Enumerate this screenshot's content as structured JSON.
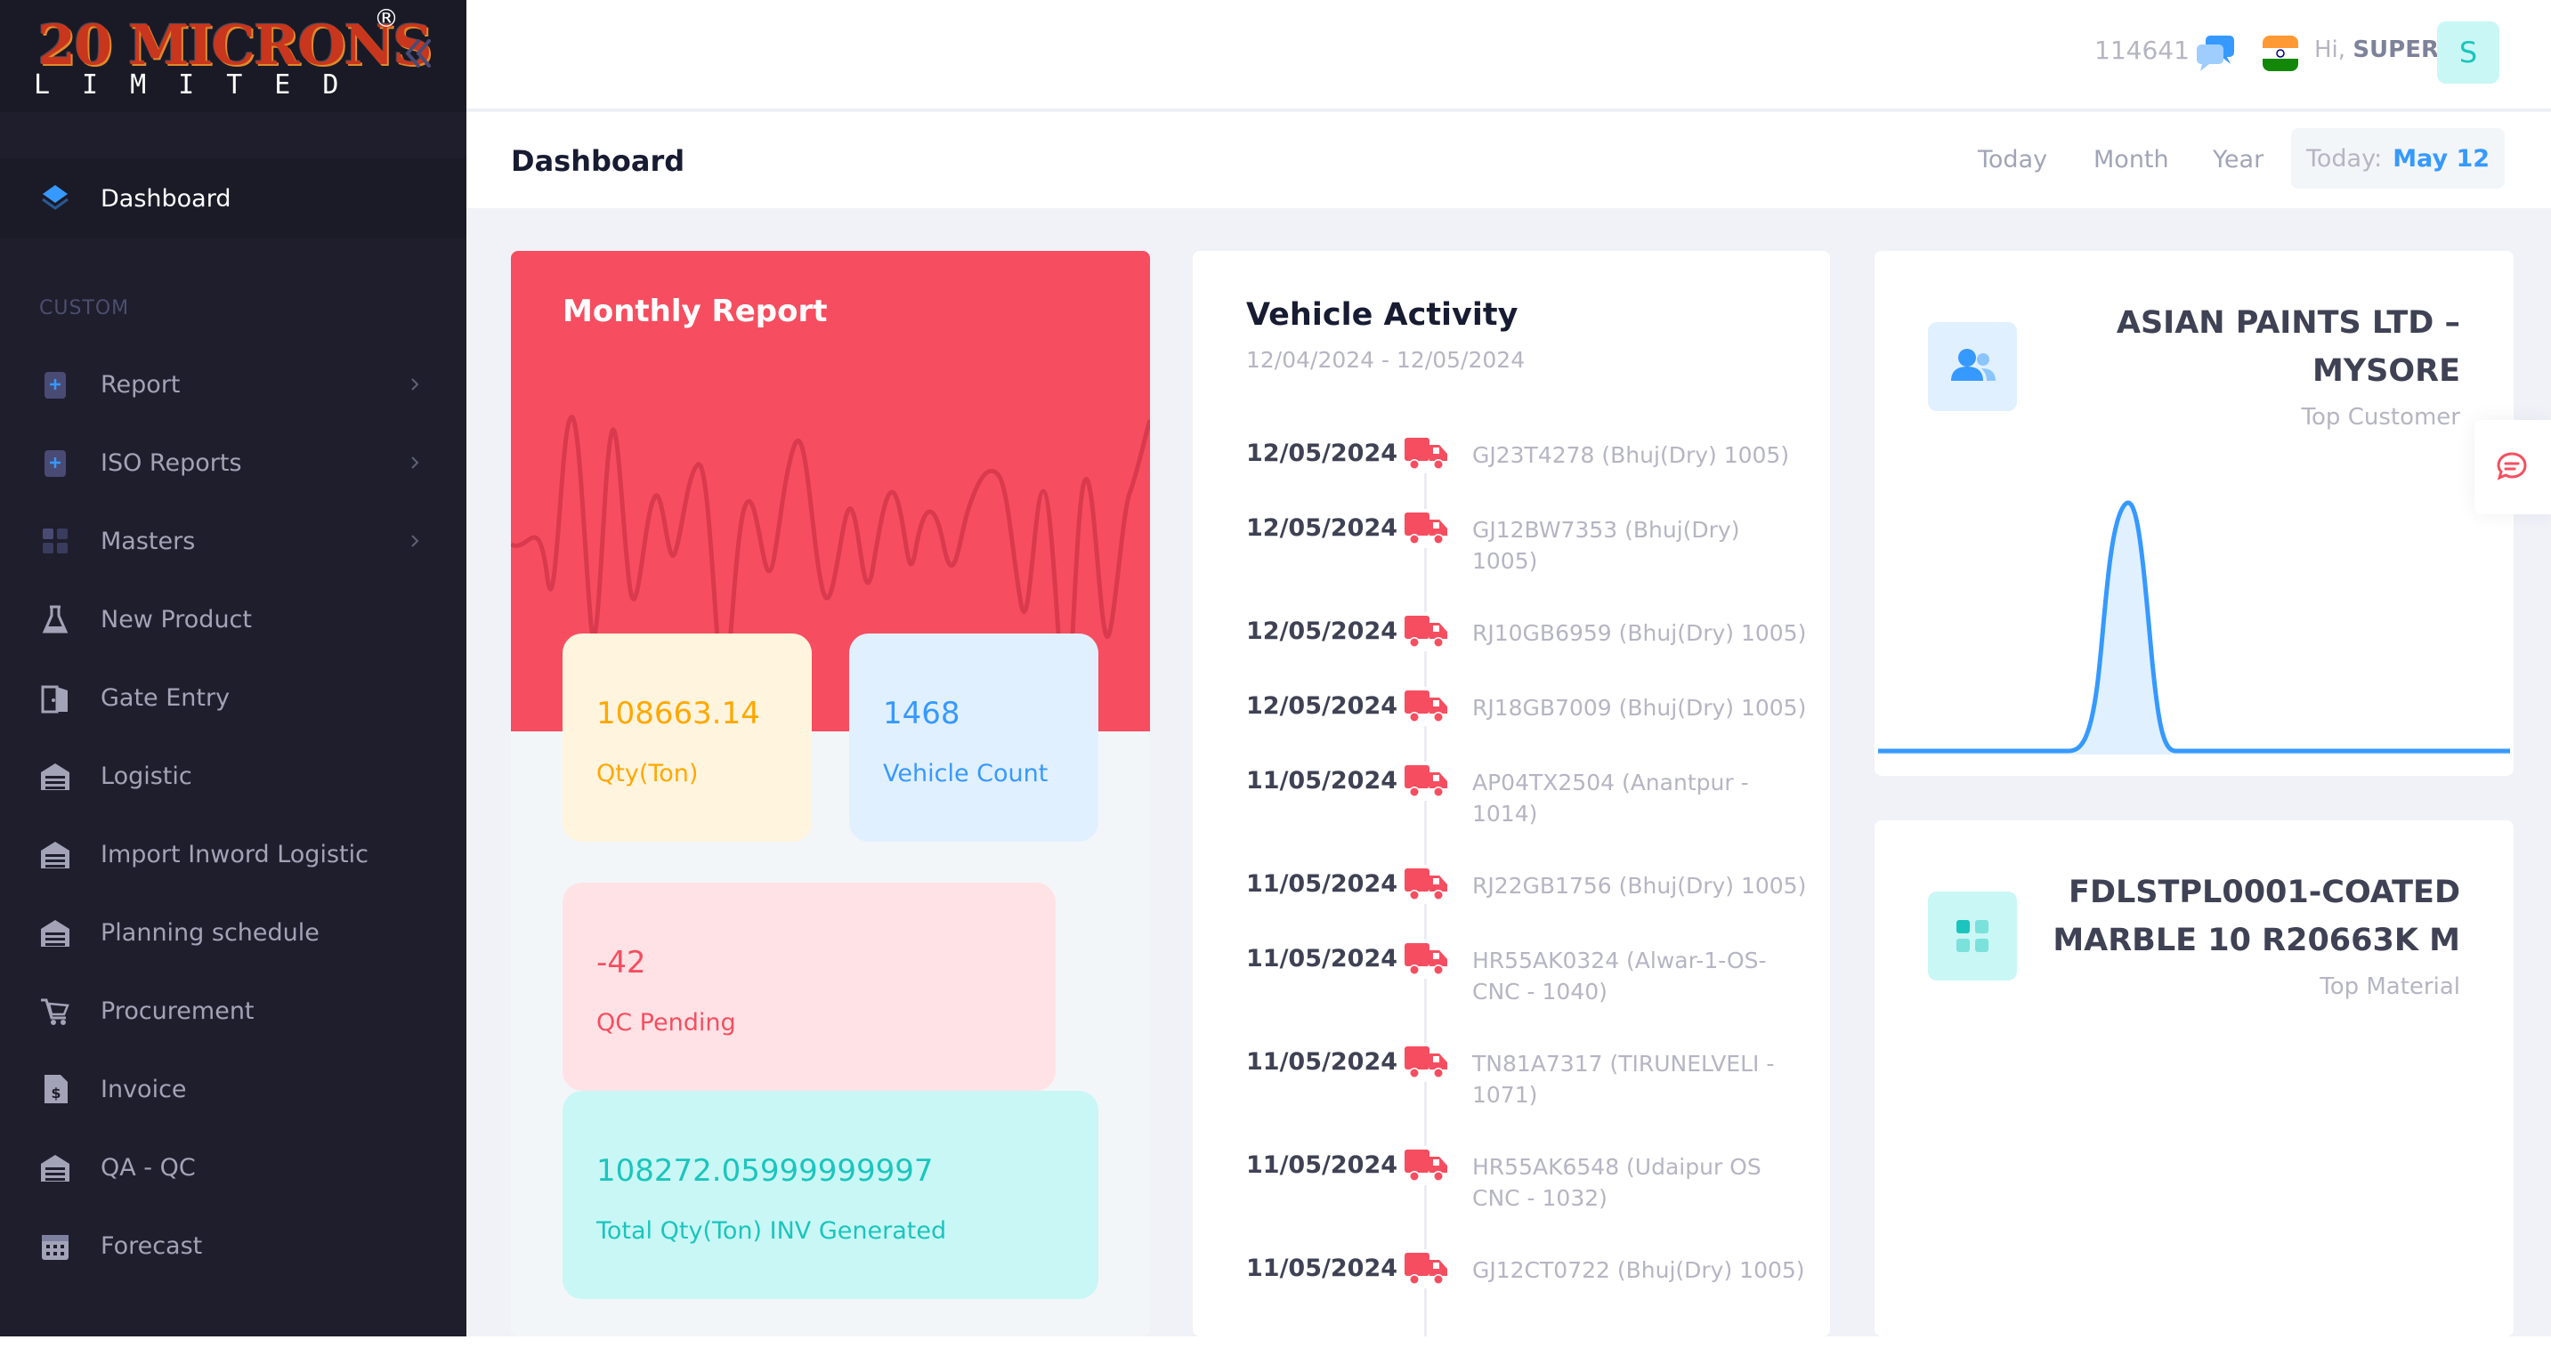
{
  "brand": {
    "logo_main": "20 MICRONS",
    "logo_registered": "®",
    "logo_sub": "LIMITED"
  },
  "sidebar": {
    "active_item": "Dashboard",
    "section_label": "CUSTOM",
    "items": [
      {
        "label": "Report",
        "icon": "plus-doc-icon",
        "chevron": true
      },
      {
        "label": "ISO Reports",
        "icon": "plus-doc-icon",
        "chevron": true
      },
      {
        "label": "Masters",
        "icon": "grid-icon",
        "chevron": true
      },
      {
        "label": "New Product",
        "icon": "flask-icon",
        "chevron": false
      },
      {
        "label": "Gate Entry",
        "icon": "door-icon",
        "chevron": false
      },
      {
        "label": "Logistic",
        "icon": "warehouse-icon",
        "chevron": false
      },
      {
        "label": "Import Inword Logistic",
        "icon": "warehouse-icon",
        "chevron": false
      },
      {
        "label": "Planning schedule",
        "icon": "warehouse-icon",
        "chevron": false
      },
      {
        "label": "Procurement",
        "icon": "cart-icon",
        "chevron": false
      },
      {
        "label": "Invoice",
        "icon": "invoice-icon",
        "chevron": false
      },
      {
        "label": "QA - QC",
        "icon": "warehouse-icon",
        "chevron": false
      },
      {
        "label": "Forecast",
        "icon": "calendar-icon",
        "chevron": false
      }
    ]
  },
  "header": {
    "user_id": "114641",
    "greeting": "Hi,",
    "user_name": "SUPER",
    "avatar_letter": "S"
  },
  "subheader": {
    "title": "Dashboard",
    "filters": [
      "Today",
      "Month",
      "Year"
    ],
    "today_label": "Today:",
    "today_value": "May 12"
  },
  "monthly_report": {
    "title": "Monthly Report",
    "stats": [
      {
        "value": "108663.14",
        "label": "Qty(Ton)"
      },
      {
        "value": "1468",
        "label": "Vehicle Count"
      },
      {
        "value": "-42",
        "label": "QC Pending"
      },
      {
        "value": "108272.05999999997",
        "label": "Total Qty(Ton) INV Generated"
      }
    ]
  },
  "vehicle_activity": {
    "title": "Vehicle Activity",
    "range": "12/04/2024 - 12/05/2024",
    "entries": [
      {
        "date": "12/05/2024",
        "text": "GJ23T4278 (Bhuj(Dry) 1005)"
      },
      {
        "date": "12/05/2024",
        "text": "GJ12BW7353 (Bhuj(Dry) 1005)"
      },
      {
        "date": "12/05/2024",
        "text": "RJ10GB6959 (Bhuj(Dry) 1005)"
      },
      {
        "date": "12/05/2024",
        "text": "RJ18GB7009 (Bhuj(Dry) 1005)"
      },
      {
        "date": "11/05/2024",
        "text": "AP04TX2504 (Anantpur - 1014)"
      },
      {
        "date": "11/05/2024",
        "text": "RJ22GB1756 (Bhuj(Dry) 1005)"
      },
      {
        "date": "11/05/2024",
        "text": "HR55AK0324 (Alwar-1-OS-CNC - 1040)"
      },
      {
        "date": "11/05/2024",
        "text": "TN81A7317 (TIRUNELVELI - 1071)"
      },
      {
        "date": "11/05/2024",
        "text": "HR55AK6548 (Udaipur OS CNC - 1032)"
      },
      {
        "date": "11/05/2024",
        "text": "GJ12CT0722 (Bhuj(Dry) 1005)"
      }
    ]
  },
  "top_customer": {
    "name": "ASIAN PAINTS LTD – MYSORE",
    "caption": "Top Customer"
  },
  "top_material": {
    "name": "FDLSTPL0001-COATED MARBLE 10 R20663K M",
    "caption": "Top Material"
  },
  "colors": {
    "sidebar_bg": "#1e1e2d",
    "danger": "#f64e60",
    "primary": "#3699ff",
    "warning": "#ffa800",
    "success": "#1bc5bd"
  }
}
